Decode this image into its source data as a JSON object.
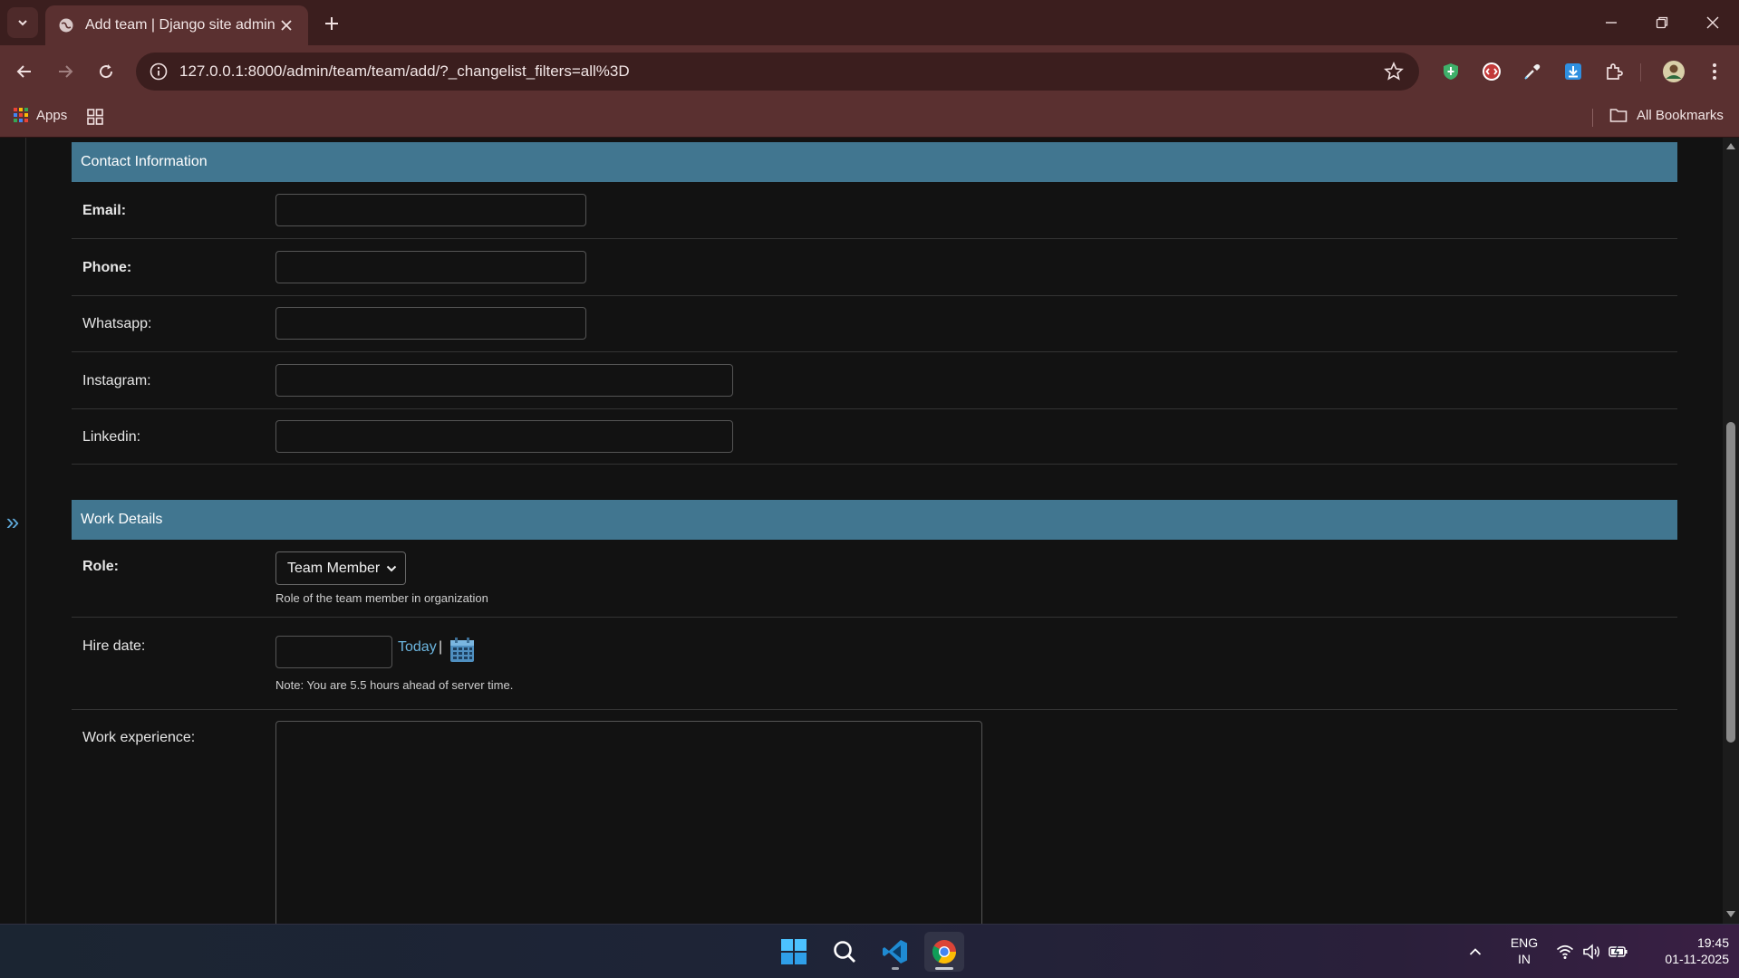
{
  "browser": {
    "tab_title": "Add team | Django site admin",
    "url": "127.0.0.1:8000/admin/team/team/add/?_changelist_filters=all%3D",
    "bookmarks": {
      "apps_label": "Apps",
      "all_bookmarks_label": "All Bookmarks"
    }
  },
  "sidebar": {
    "toggle_glyph": "»"
  },
  "sections": {
    "contact": {
      "title": "Contact Information",
      "fields": {
        "email": {
          "label": "Email:",
          "value": ""
        },
        "phone": {
          "label": "Phone:",
          "value": ""
        },
        "whatsapp": {
          "label": "Whatsapp:",
          "value": ""
        },
        "instagram": {
          "label": "Instagram:",
          "value": ""
        },
        "linkedin": {
          "label": "Linkedin:",
          "value": ""
        }
      }
    },
    "work": {
      "title": "Work Details",
      "role": {
        "label": "Role:",
        "selected": "Team Member",
        "help": "Role of the team member in organization"
      },
      "hire_date": {
        "label": "Hire date:",
        "value": "",
        "today_link": "Today",
        "separator": "|",
        "note": "Note: You are 5.5 hours ahead of server time."
      },
      "work_experience": {
        "label": "Work experience:",
        "value": ""
      }
    }
  },
  "taskbar": {
    "language_line1": "ENG",
    "language_line2": "IN",
    "time": "19:45",
    "date": "01-11-2025"
  },
  "colors": {
    "section_header": "#417690",
    "link": "#6cb6e0",
    "tabbar": "#3b1e1e",
    "toolbar": "#5a3030"
  }
}
